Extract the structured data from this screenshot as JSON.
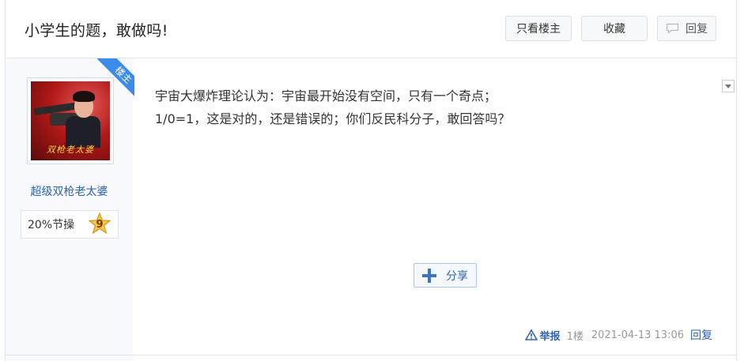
{
  "thread": {
    "title": "小学生的题，敢做吗!"
  },
  "toolbar": {
    "only_op_label": "只看楼主",
    "favorite_label": "收藏",
    "reply_label": "回复"
  },
  "author": {
    "username": "超级双枪老太婆",
    "level_text": "20%节操",
    "level_number": "9",
    "avatar_caption": "双枪老太婆",
    "op_badge": "楼主"
  },
  "post": {
    "lines": [
      "宇宙大爆炸理论认为：宇宙最开始没有空间，只有一个奇点；",
      "1/0=1，这是对的，还是错误的；你们反民科分子，敢回答吗？"
    ],
    "share_label": "分享",
    "report_label": "举报",
    "floor": "1楼",
    "timestamp": "2021-04-13 13:06",
    "reply_label": "回复"
  },
  "colors": {
    "link": "#2d64b3",
    "ribbon": "#3d8be8",
    "sidebar_bg": "#f7f9fc"
  }
}
